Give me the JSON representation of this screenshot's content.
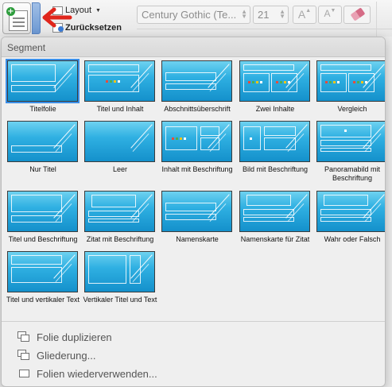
{
  "toolbar": {
    "layout_label": "Layout",
    "reset_label": "Zurücksetzen",
    "font_name": "Century Gothic (Te...",
    "font_size": "21",
    "grow_font_glyph": "A",
    "shrink_font_glyph": "A"
  },
  "gallery": {
    "header": "Segment",
    "selected_index": 0,
    "layouts": [
      {
        "label": "Titelfolie"
      },
      {
        "label": "Titel und Inhalt"
      },
      {
        "label": "Abschnittsüberschrift"
      },
      {
        "label": "Zwei Inhalte"
      },
      {
        "label": "Vergleich"
      },
      {
        "label": "Nur Titel"
      },
      {
        "label": "Leer"
      },
      {
        "label": "Inhalt mit Beschriftung"
      },
      {
        "label": "Bild mit Beschriftung"
      },
      {
        "label": "Panoramabild mit Beschriftung"
      },
      {
        "label": "Titel und Beschriftung"
      },
      {
        "label": "Zitat mit Beschriftung"
      },
      {
        "label": "Namenskarte"
      },
      {
        "label": "Namenskarte für Zitat"
      },
      {
        "label": "Wahr oder Falsch"
      },
      {
        "label": "Titel und vertikaler Text"
      },
      {
        "label": "Vertikaler Titel und Text"
      }
    ]
  },
  "menu": {
    "duplicate": "Folie duplizieren",
    "outline": "Gliederung...",
    "reuse": "Folien wiederverwenden..."
  },
  "colors": {
    "thumbnail_gradient_top": "#6ed2f0",
    "thumbnail_gradient_bottom": "#1490cb",
    "selection": "#3a8ee6",
    "annotation_arrow": "#e0261c"
  },
  "icons": {
    "new_slide": "new-slide-icon",
    "layout": "layout-icon",
    "reset": "reset-icon",
    "clear_format": "eraser-icon",
    "menu_duplicate": "duplicate-slides-icon",
    "menu_outline": "outline-icon",
    "menu_reuse": "reuse-slides-icon"
  }
}
